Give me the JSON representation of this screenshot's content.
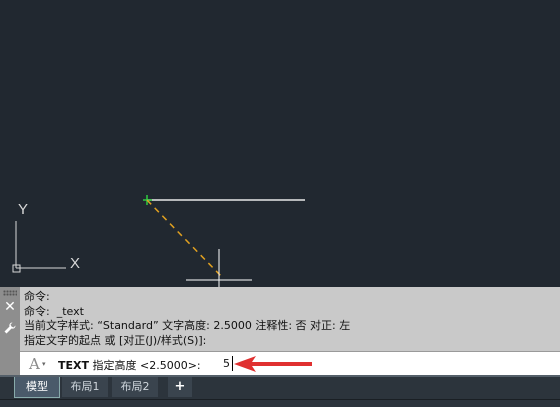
{
  "ucs": {
    "x_label": "X",
    "y_label": "Y"
  },
  "command_panel": {
    "history": [
      "命令:",
      "命令:  _text",
      "当前文字样式: “Standard” 文字高度: 2.5000 注释性: 否 对正: 左",
      "指定文字的起点 或 [对正(J)/样式(S)]:"
    ],
    "prompt_command": "TEXT",
    "prompt_text": " 指定高度 <2.5000>:",
    "input_value": "5",
    "close_icon": "close-icon",
    "settings_icon": "wrench-icon",
    "text_style_icon": "A",
    "text_style_arrow": "▾"
  },
  "tabs": [
    {
      "label": "模型",
      "active": true
    },
    {
      "label": "布局1",
      "active": false
    },
    {
      "label": "布局2",
      "active": false
    }
  ],
  "add_tab": "+",
  "colors": {
    "background": "#212830",
    "rubber_band": "#e0a020",
    "crosshair": "#ffffff",
    "arrow": "#e03030"
  }
}
